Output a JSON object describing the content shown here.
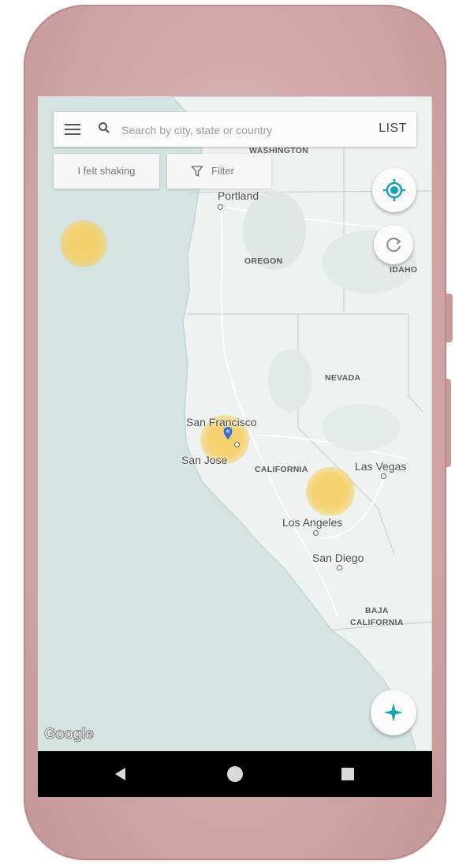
{
  "search": {
    "placeholder": "Search by city, state or country",
    "list_label": "LIST"
  },
  "chips": {
    "felt_label": "I felt shaking",
    "filter_label": "Filter"
  },
  "map": {
    "states": {
      "washington": "WASHINGTON",
      "oregon": "OREGON",
      "idaho": "IDAHO",
      "nevada": "NEVADA",
      "california": "CALIFORNIA",
      "baja": "BAJA\nCALIFORNIA"
    },
    "cities": {
      "portland": "Portland",
      "san_francisco": "San Francisco",
      "san_jose": "San Jose",
      "las_vegas": "Las Vegas",
      "los_angeles": "Los Angeles",
      "san_diego": "San Diego"
    },
    "attribution": "Google"
  },
  "icons": {
    "menu": "menu-icon",
    "search": "search-icon",
    "filter": "filter-icon",
    "my_location": "my-location-icon",
    "refresh": "refresh-icon",
    "compass": "compass-icon"
  },
  "colors": {
    "accent": "#1ba3b2",
    "quake": "#f6ce60",
    "map_land": "#eef2f0",
    "map_water": "#d6e3e3",
    "phone_frame": "#d4abab"
  }
}
